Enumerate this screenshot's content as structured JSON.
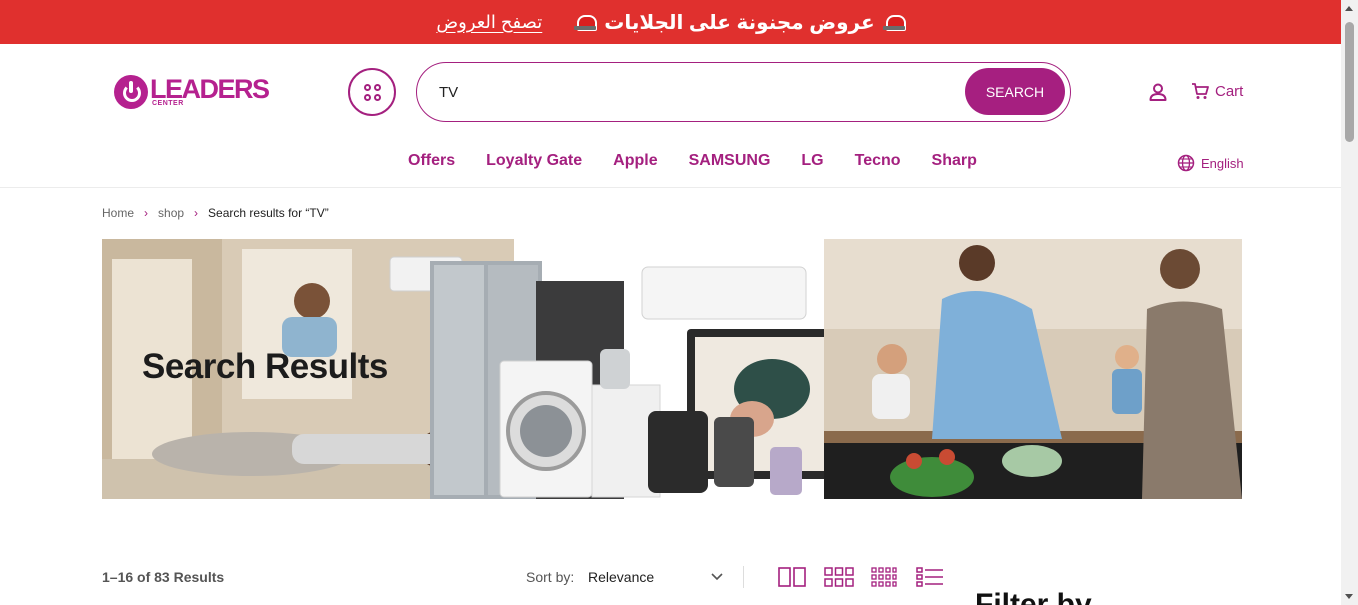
{
  "promo": {
    "headline": "عروض مجنونة على الجلايات",
    "link_label": "تصفح العروض"
  },
  "header": {
    "logo_text": "LEADERS",
    "logo_subtext": "CENTER",
    "search_value": "TV",
    "search_button": "SEARCH",
    "cart_label": "Cart"
  },
  "nav": {
    "items": [
      "Offers",
      "Loyalty Gate",
      "Apple",
      "SAMSUNG",
      "LG",
      "Tecno",
      "Sharp"
    ],
    "language": "English"
  },
  "breadcrumb": {
    "home": "Home",
    "shop": "shop",
    "current": "Search results for “TV”"
  },
  "banner": {
    "title": "Search Results"
  },
  "toolbar": {
    "results": "1–16 of 83 Results",
    "sort_label": "Sort by:",
    "sort_value": "Relevance"
  },
  "sidebar": {
    "filter_title": "Filter by"
  },
  "colors": {
    "promo_bg": "#e0302e",
    "brand": "#a4207f"
  }
}
